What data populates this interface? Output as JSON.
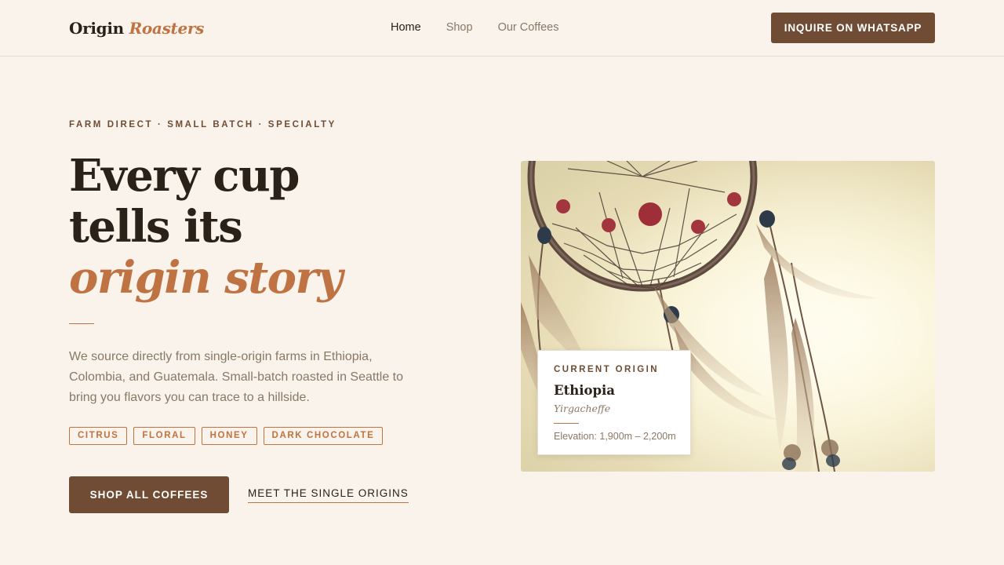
{
  "brand": {
    "name": "Origin",
    "name_accent": "Roasters"
  },
  "nav": {
    "items": [
      {
        "label": "Home",
        "active": true
      },
      {
        "label": "Shop",
        "active": false
      },
      {
        "label": "Our Coffees",
        "active": false
      }
    ]
  },
  "header": {
    "cta_label": "INQUIRE ON WHATSAPP"
  },
  "hero": {
    "eyebrow": "FARM DIRECT · SMALL BATCH · SPECIALTY",
    "headline_line1": "Every cup",
    "headline_line2": "tells its",
    "headline_line3": "origin story",
    "description": "We source directly from single-origin farms in Ethiopia, Colombia, and Guatemala. Small-batch roasted in Seattle to bring you flavors you can trace to a hillside.",
    "tags": [
      "CITRUS",
      "FLORAL",
      "HONEY",
      "DARK CHOCOLATE"
    ],
    "primary_button": "SHOP ALL COFFEES",
    "secondary_link": "MEET THE SINGLE ORIGINS"
  },
  "origin_card": {
    "label": "CURRENT ORIGIN",
    "country": "Ethiopia",
    "region": "Yirgacheffe",
    "elevation": "Elevation: 1,900m – 2,200m"
  },
  "colors": {
    "background": "#f9f3ec",
    "accent": "#c07342",
    "primary": "#6f4c33",
    "text": "#2a2118",
    "muted": "#8a7866"
  }
}
